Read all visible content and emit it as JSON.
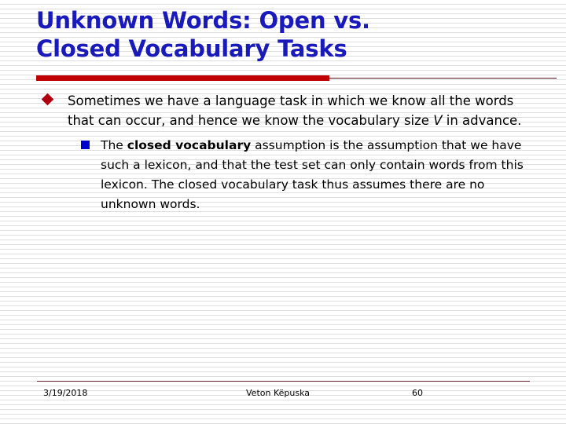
{
  "slide": {
    "title": "Unknown Words: Open vs.\nClosed Vocabulary Tasks",
    "title_color": "#1a1aba",
    "rule_color_thick": "#c00000",
    "rule_color_thin": "#5c1020",
    "background_color": "#ffffff"
  },
  "bullets": {
    "level1": {
      "marker": "diamond-bullet",
      "marker_color": "#b00010",
      "text_part1": "Sometimes we have a language task in which we know all the words that can occur, and hence we know the vocabulary size ",
      "text_italic": "V",
      "text_part2": " in advance."
    },
    "level2": {
      "marker": "square-bullet",
      "marker_color": "#0000cc",
      "text_part1": "The ",
      "text_bold": "closed vocabulary",
      "text_part2": " assumption is the assumption that we have such a lexicon, and that the test set can only contain words from this lexicon. The closed vocabulary task thus assumes there are no unknown words."
    }
  },
  "footer": {
    "date": "3/19/2018",
    "author": "Veton Këpuska",
    "page_number": "60",
    "rule_color": "#6b1f2e"
  }
}
